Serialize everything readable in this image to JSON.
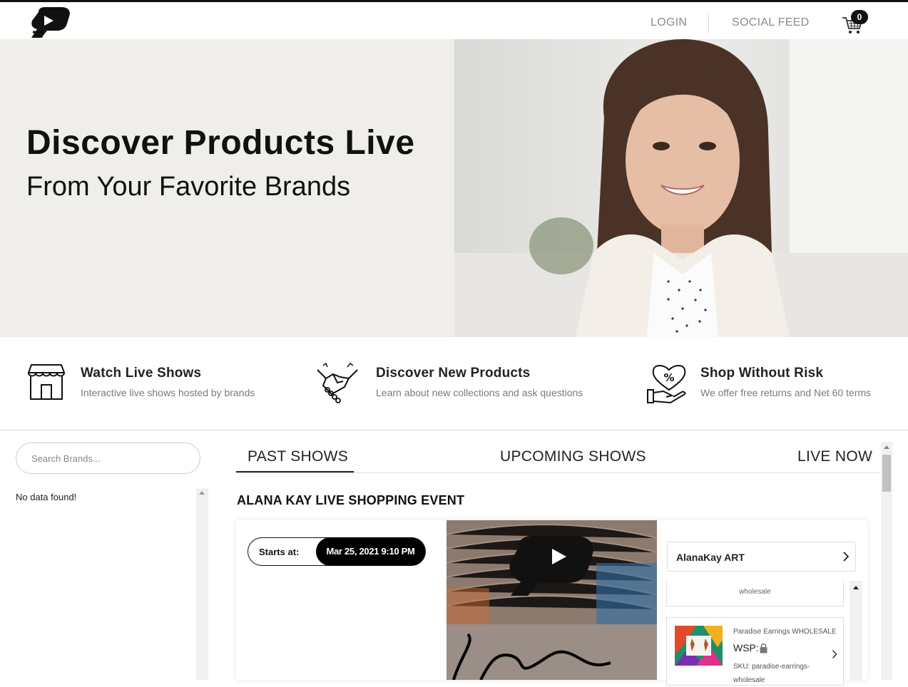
{
  "header": {
    "login_label": "LOGIN",
    "social_feed_label": "SOCIAL FEED",
    "cart_count": "0"
  },
  "hero": {
    "title": "Discover Products Live",
    "subtitle": "From Your Favorite Brands"
  },
  "features": [
    {
      "icon": "storefront-icon",
      "title": "Watch Live Shows",
      "desc": "Interactive live shows hosted by brands"
    },
    {
      "icon": "handshake-icon",
      "title": "Discover New Products",
      "desc": "Learn about new collections and ask questions"
    },
    {
      "icon": "heart-percent-hand-icon",
      "title": "Shop Without Risk",
      "desc": "We offer free returns and Net 60 terms"
    }
  ],
  "search": {
    "placeholder": "Search Brands..."
  },
  "brands_empty_text": "No data found!",
  "tabs": [
    "PAST SHOWS",
    "UPCOMING SHOWS",
    "LIVE NOW"
  ],
  "active_tab": "PAST SHOWS",
  "event": {
    "title": "ALANA KAY LIVE SHOPPING EVENT",
    "starts_label": "Starts at:",
    "starts_date": "Mar 25, 2021 9:10 PM",
    "brand_name": "AlanaKay ART",
    "prev_product_tail": "wholesale",
    "product": {
      "name": "Paradise Earrings WHOLESALE",
      "wsp_label": "WSP:",
      "sku": "SKU: paradise-earrings-wholesale"
    }
  },
  "colors": {
    "text": "#111111",
    "nav": "#8a8a8a",
    "hero_bg": "#f0eeeb",
    "accent": "#000000"
  }
}
